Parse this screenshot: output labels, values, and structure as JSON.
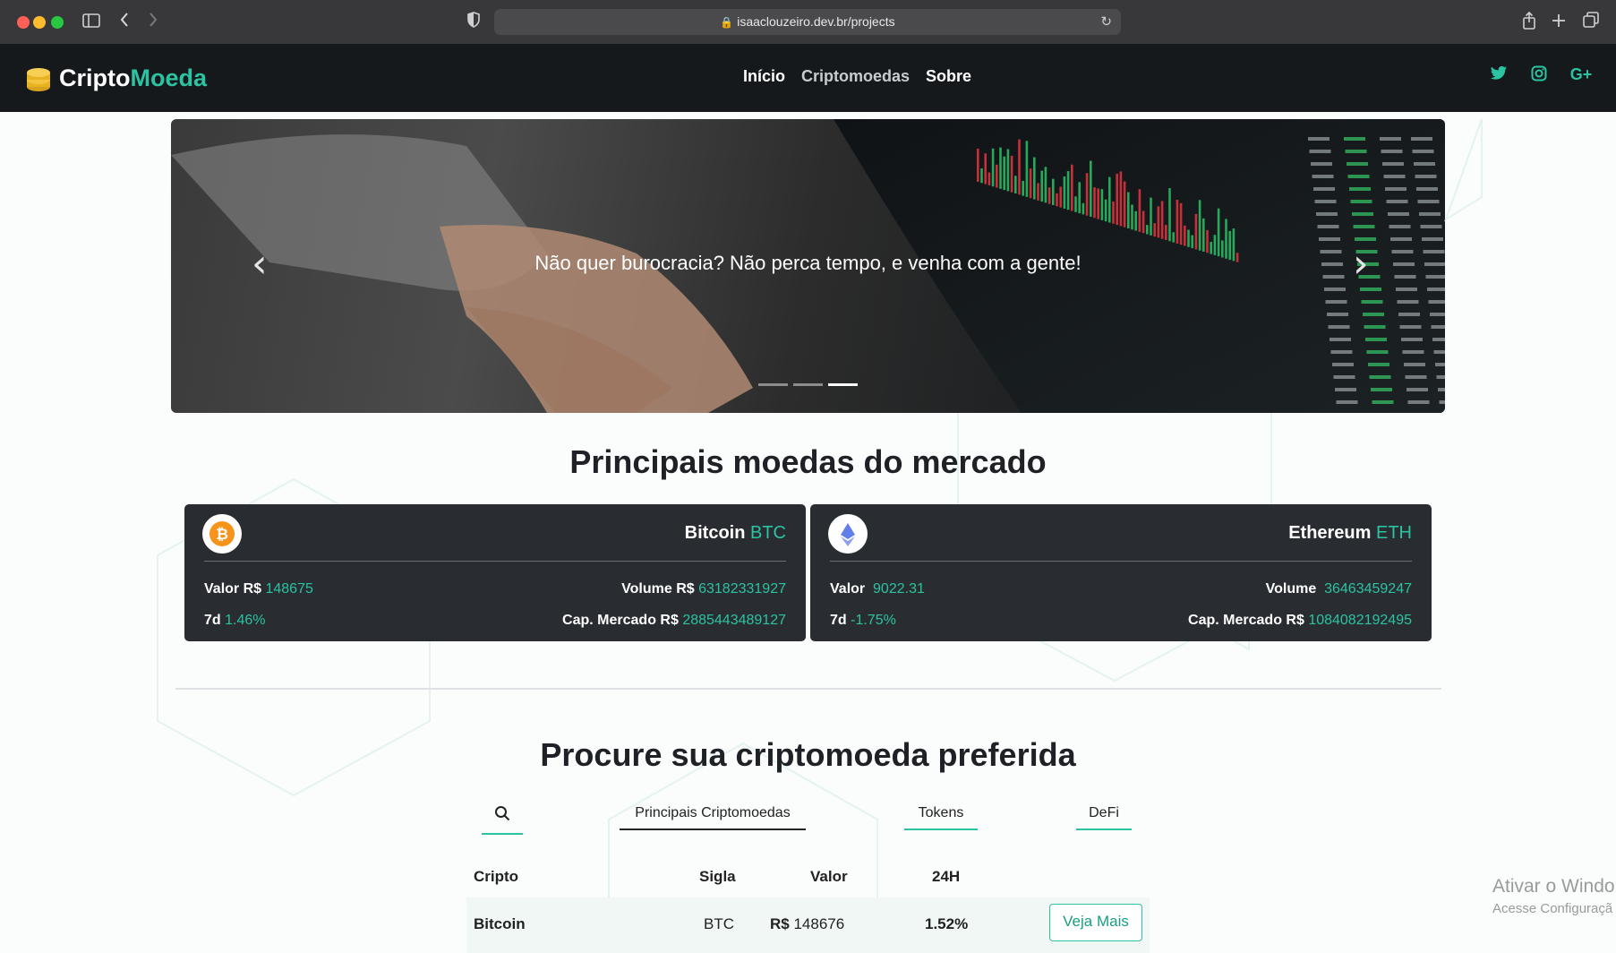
{
  "browser": {
    "url": "isaaclouzeiro.dev.br/projects"
  },
  "site": {
    "logo_part1": "Cripto",
    "logo_part2": "Moeda",
    "nav": [
      "Início",
      "Criptomoedas",
      "Sobre"
    ],
    "social_icons": [
      "twitter-icon",
      "instagram-icon",
      "google-plus-icon"
    ],
    "social_gplus": "G+"
  },
  "hero": {
    "caption": "Não quer burocracia? Não perca tempo, e venha com a gente!",
    "slides": 3,
    "active_slide": 3
  },
  "market": {
    "title": "Principais moedas do mercado",
    "coins": [
      {
        "name": "Bitcoin",
        "symbol": "BTC",
        "valor_label": "Valor R$",
        "valor": "148675",
        "volume_label": "Volume R$",
        "volume": "63182331927",
        "change_label": "7d",
        "change": "1.46%",
        "cap_label": "Cap. Mercado R$",
        "cap": "2885443489127"
      },
      {
        "name": "Ethereum",
        "symbol": "ETH",
        "valor_label": "Valor",
        "valor": "9022.31",
        "volume_label": "Volume",
        "volume": "36463459247",
        "change_label": "7d",
        "change": "-1.75%",
        "cap_label": "Cap. Mercado R$",
        "cap": "1084082192495"
      }
    ]
  },
  "search": {
    "title": "Procure sua criptomoeda preferida",
    "tabs": [
      "Principais Criptomoedas",
      "Tokens",
      "DeFi"
    ],
    "active_tab": "Principais Criptomoedas",
    "columns": [
      "Cripto",
      "Sigla",
      "Valor",
      "24H"
    ],
    "rows": [
      {
        "cripto": "Bitcoin",
        "sigla": "BTC",
        "valor_prefix": "R$",
        "valor": "148676",
        "change": "1.52%",
        "action": "Veja Mais"
      }
    ]
  },
  "watermark": {
    "line1": "Ativar o Windo",
    "line2": "Acesse Configuraçã"
  },
  "colors": {
    "accent": "#2bc3a1",
    "nav_bg": "#16191c",
    "card_bg": "#292d31"
  }
}
